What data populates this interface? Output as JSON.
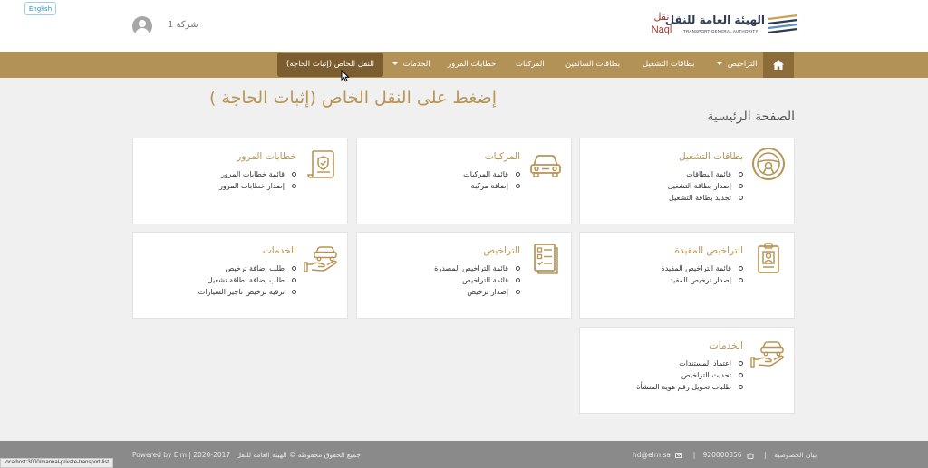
{
  "header": {
    "lang_button": "English",
    "company_name": "شركة 1",
    "naql_ar": "نقل",
    "naql_en": "Naql",
    "authority_ar": "الهيئة العامة للنقل",
    "authority_en": "TRANSPORT GENERAL AUTHORITY"
  },
  "nav": {
    "home_icon": "home-icon",
    "items": [
      {
        "label": "التراخيص",
        "dropdown": true
      },
      {
        "label": "بطاقات التشغيل"
      },
      {
        "label": "بطاقات السائقين"
      },
      {
        "label": "المركبات"
      },
      {
        "label": "خطابات المرور"
      },
      {
        "label": "الخدمات",
        "dropdown": true
      },
      {
        "label": "النقل الخاص (إثبات الحاجة)",
        "active": true
      }
    ]
  },
  "main": {
    "promo": "إضغط على النقل الخاص (إثبات الحاجة )",
    "page_title": "الصفحة الرئيسية",
    "cards": [
      {
        "title": "بطاقات التشغيل",
        "icon": "steering-wheel-icon",
        "items": [
          "قائمة البطاقات",
          "إصدار بطاقة التشغيل",
          "تجديد بطاقة التشغيل"
        ]
      },
      {
        "title": "المركبات",
        "icon": "car-icon",
        "items": [
          "قائمة المركبات",
          "إضافة مركبة"
        ]
      },
      {
        "title": "خطابات المرور",
        "icon": "certificate-icon",
        "items": [
          "قائمة خطابات المرور",
          "إصدار خطابات المرور"
        ]
      },
      {
        "title": "التراخيص المقيدة",
        "icon": "id-badge-icon",
        "items": [
          "قائمة التراخيص المقيدة",
          "إصدار ترخيص المقيد"
        ]
      },
      {
        "title": "التراخيص",
        "icon": "checklist-icon",
        "items": [
          "قائمة التراخيص المصدرة",
          "قائمة التراخيص",
          "إصدار ترخيص"
        ]
      },
      {
        "title": "الخدمات",
        "icon": "car-in-hand-icon",
        "items": [
          "طلب إضافة ترخيص",
          "طلب إضافة بطاقة تشغيل",
          "ترقية ترخيص تاجير السيارات"
        ]
      },
      {
        "title": "الخدمات",
        "icon": "car-in-hand-icon",
        "items": [
          "اعتماد المستندات",
          "تحديث التراخيص",
          "طلبات تحويل رقم هوية المنشأة"
        ]
      }
    ]
  },
  "footer": {
    "powered": "Powered by Elm | 2020-2017",
    "copyright": "جميع الحقوق محفوظة © الهيئة العامة للنقل",
    "email": "hd@elm.sa",
    "phone": "920000356",
    "privacy": "بيان الخصوصية"
  },
  "status_bar_url": "localhost:3000/manual-private-transport-list",
  "colors": {
    "gold": "#b39258",
    "accent_text": "#b79556",
    "active_nav": "#7b5d2f",
    "footer": "#8a8a8a",
    "naql_red": "#a33b2e"
  }
}
